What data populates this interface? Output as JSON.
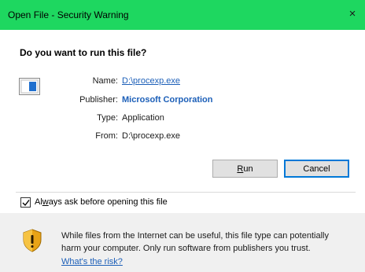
{
  "window": {
    "title": "Open File - Security Warning",
    "close_label": "×"
  },
  "question": "Do you want to run this file?",
  "file_info": {
    "name_label": "Name:",
    "name_value": "D:\\procexp.exe",
    "publisher_label": "Publisher:",
    "publisher_value": "Microsoft Corporation",
    "type_label": "Type:",
    "type_value": "Application",
    "from_label": "From:",
    "from_value": "D:\\procexp.exe"
  },
  "buttons": {
    "run_underlined": "R",
    "run_rest": "un",
    "cancel": "Cancel"
  },
  "checkbox": {
    "checked": true,
    "label_before": "Al",
    "label_underlined": "w",
    "label_after": "ays ask before opening this file"
  },
  "warning": {
    "line1": "While files from the Internet can be useful, this file type can potentially",
    "line2": "harm your computer. Only run software from publishers you trust.",
    "link": "What's the risk?"
  },
  "icons": {
    "file": "application-file-icon",
    "shield": "security-shield-icon",
    "check": "checkmark-icon"
  },
  "colors": {
    "titlebar": "#1ed760",
    "link": "#1c5fb8",
    "button_focus": "#0078d7",
    "footer": "#f0f0f0"
  }
}
